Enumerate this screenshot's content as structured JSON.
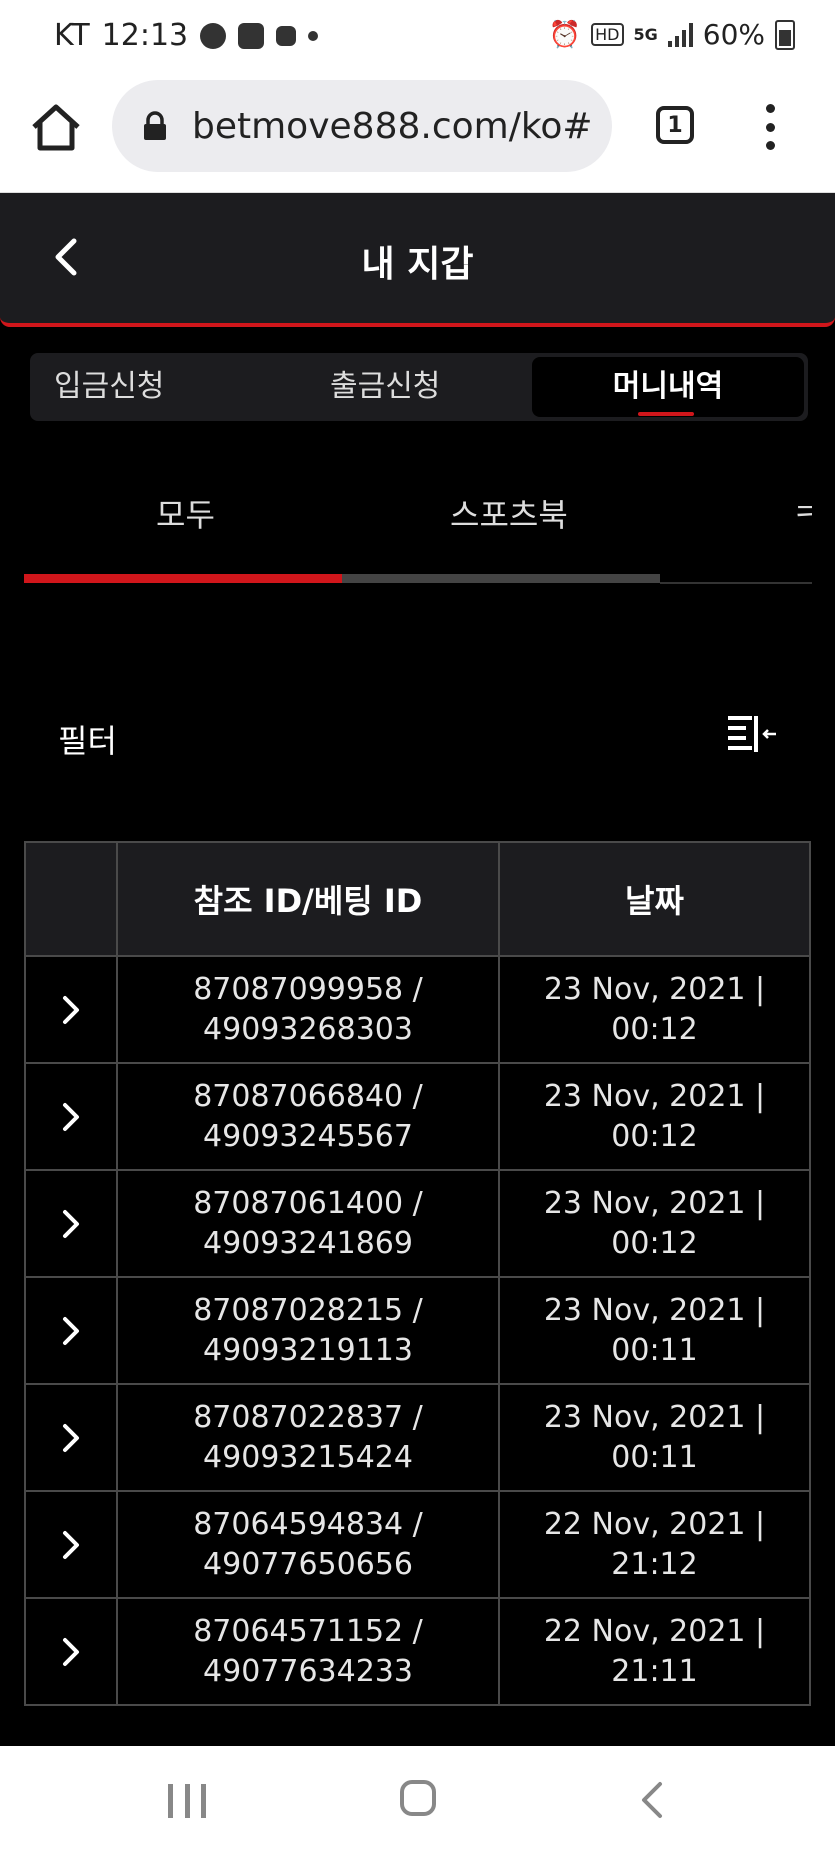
{
  "status_bar": {
    "carrier": "KT",
    "time": "12:13",
    "network": "5G",
    "battery": "60%"
  },
  "browser": {
    "url": "betmove888.com/ko#",
    "tab_count": "1"
  },
  "header": {
    "title": "내 지갑"
  },
  "wallet_tabs": [
    {
      "label": "입금신청",
      "active": false
    },
    {
      "label": "출금신청",
      "active": false
    },
    {
      "label": "머니내역",
      "active": true
    }
  ],
  "category_tabs": [
    {
      "label": "모두",
      "active": true
    },
    {
      "label": "스포츠북",
      "active": false
    },
    {
      "label": "ㅋ",
      "active": false
    }
  ],
  "category_progress": 0.5,
  "filter": {
    "label": "필터"
  },
  "table": {
    "headers": [
      "",
      "참조 ID/베팅 ID",
      "날짜"
    ],
    "rows": [
      {
        "ref": "87087099958 /",
        "bet": "49093268303",
        "date": "23 Nov, 2021 |",
        "time": "00:12"
      },
      {
        "ref": "87087066840 /",
        "bet": "49093245567",
        "date": "23 Nov, 2021 |",
        "time": "00:12"
      },
      {
        "ref": "87087061400 /",
        "bet": "49093241869",
        "date": "23 Nov, 2021 |",
        "time": "00:12"
      },
      {
        "ref": "87087028215 /",
        "bet": "49093219113",
        "date": "23 Nov, 2021 |",
        "time": "00:11"
      },
      {
        "ref": "87087022837 /",
        "bet": "49093215424",
        "date": "23 Nov, 2021 |",
        "time": "00:11"
      },
      {
        "ref": "87064594834 /",
        "bet": "49077650656",
        "date": "22 Nov, 2021 |",
        "time": "21:12"
      },
      {
        "ref": "87064571152 /",
        "bet": "49077634233",
        "date": "22 Nov, 2021 |",
        "time": "21:11"
      }
    ]
  },
  "colors": {
    "accent": "#d0161b",
    "panel": "#1c1c1f",
    "background": "#000000"
  }
}
